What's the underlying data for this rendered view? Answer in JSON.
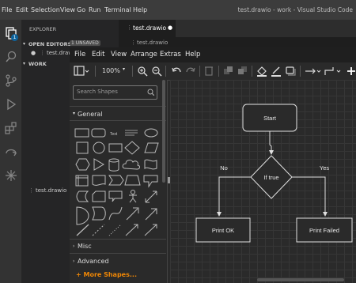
{
  "vscode": {
    "menu": [
      "File",
      "Edit",
      "Selection",
      "View",
      "Go",
      "Run",
      "Terminal",
      "Help"
    ],
    "title": "test.drawio - work - Visual Studio Code",
    "activity_badge": "1"
  },
  "explorer": {
    "header": "EXPLORER",
    "open_editors_label": "OPEN EDITORS",
    "unsaved_badge": "1 UNSAVED",
    "open_file": "test.drawio",
    "work_label": "WORK",
    "work_file": "test.drawio"
  },
  "editor": {
    "tab_label": "test.drawio",
    "breadcrumb": "test.drawio"
  },
  "drawio": {
    "menu": [
      "File",
      "Edit",
      "View",
      "Arrange",
      "Extras",
      "Help"
    ],
    "zoom": "100%",
    "search_placeholder": "Search Shapes",
    "sections": {
      "general": "General",
      "misc": "Misc",
      "advanced": "Advanced",
      "more_shapes": "+ More Shapes..."
    },
    "text_shape_label": "Text",
    "diagram": {
      "start": "Start",
      "decision": "If true",
      "no": "No",
      "yes": "Yes",
      "left_box": "Print OK",
      "right_box": "Print Failed"
    }
  },
  "colors": {
    "titlebar": "#3c3c3c",
    "activity": "#333333",
    "explorer": "#252526",
    "accent": "#0e639c",
    "more_shapes": "#f08705",
    "diagram_stroke": "#e0e0e0"
  }
}
